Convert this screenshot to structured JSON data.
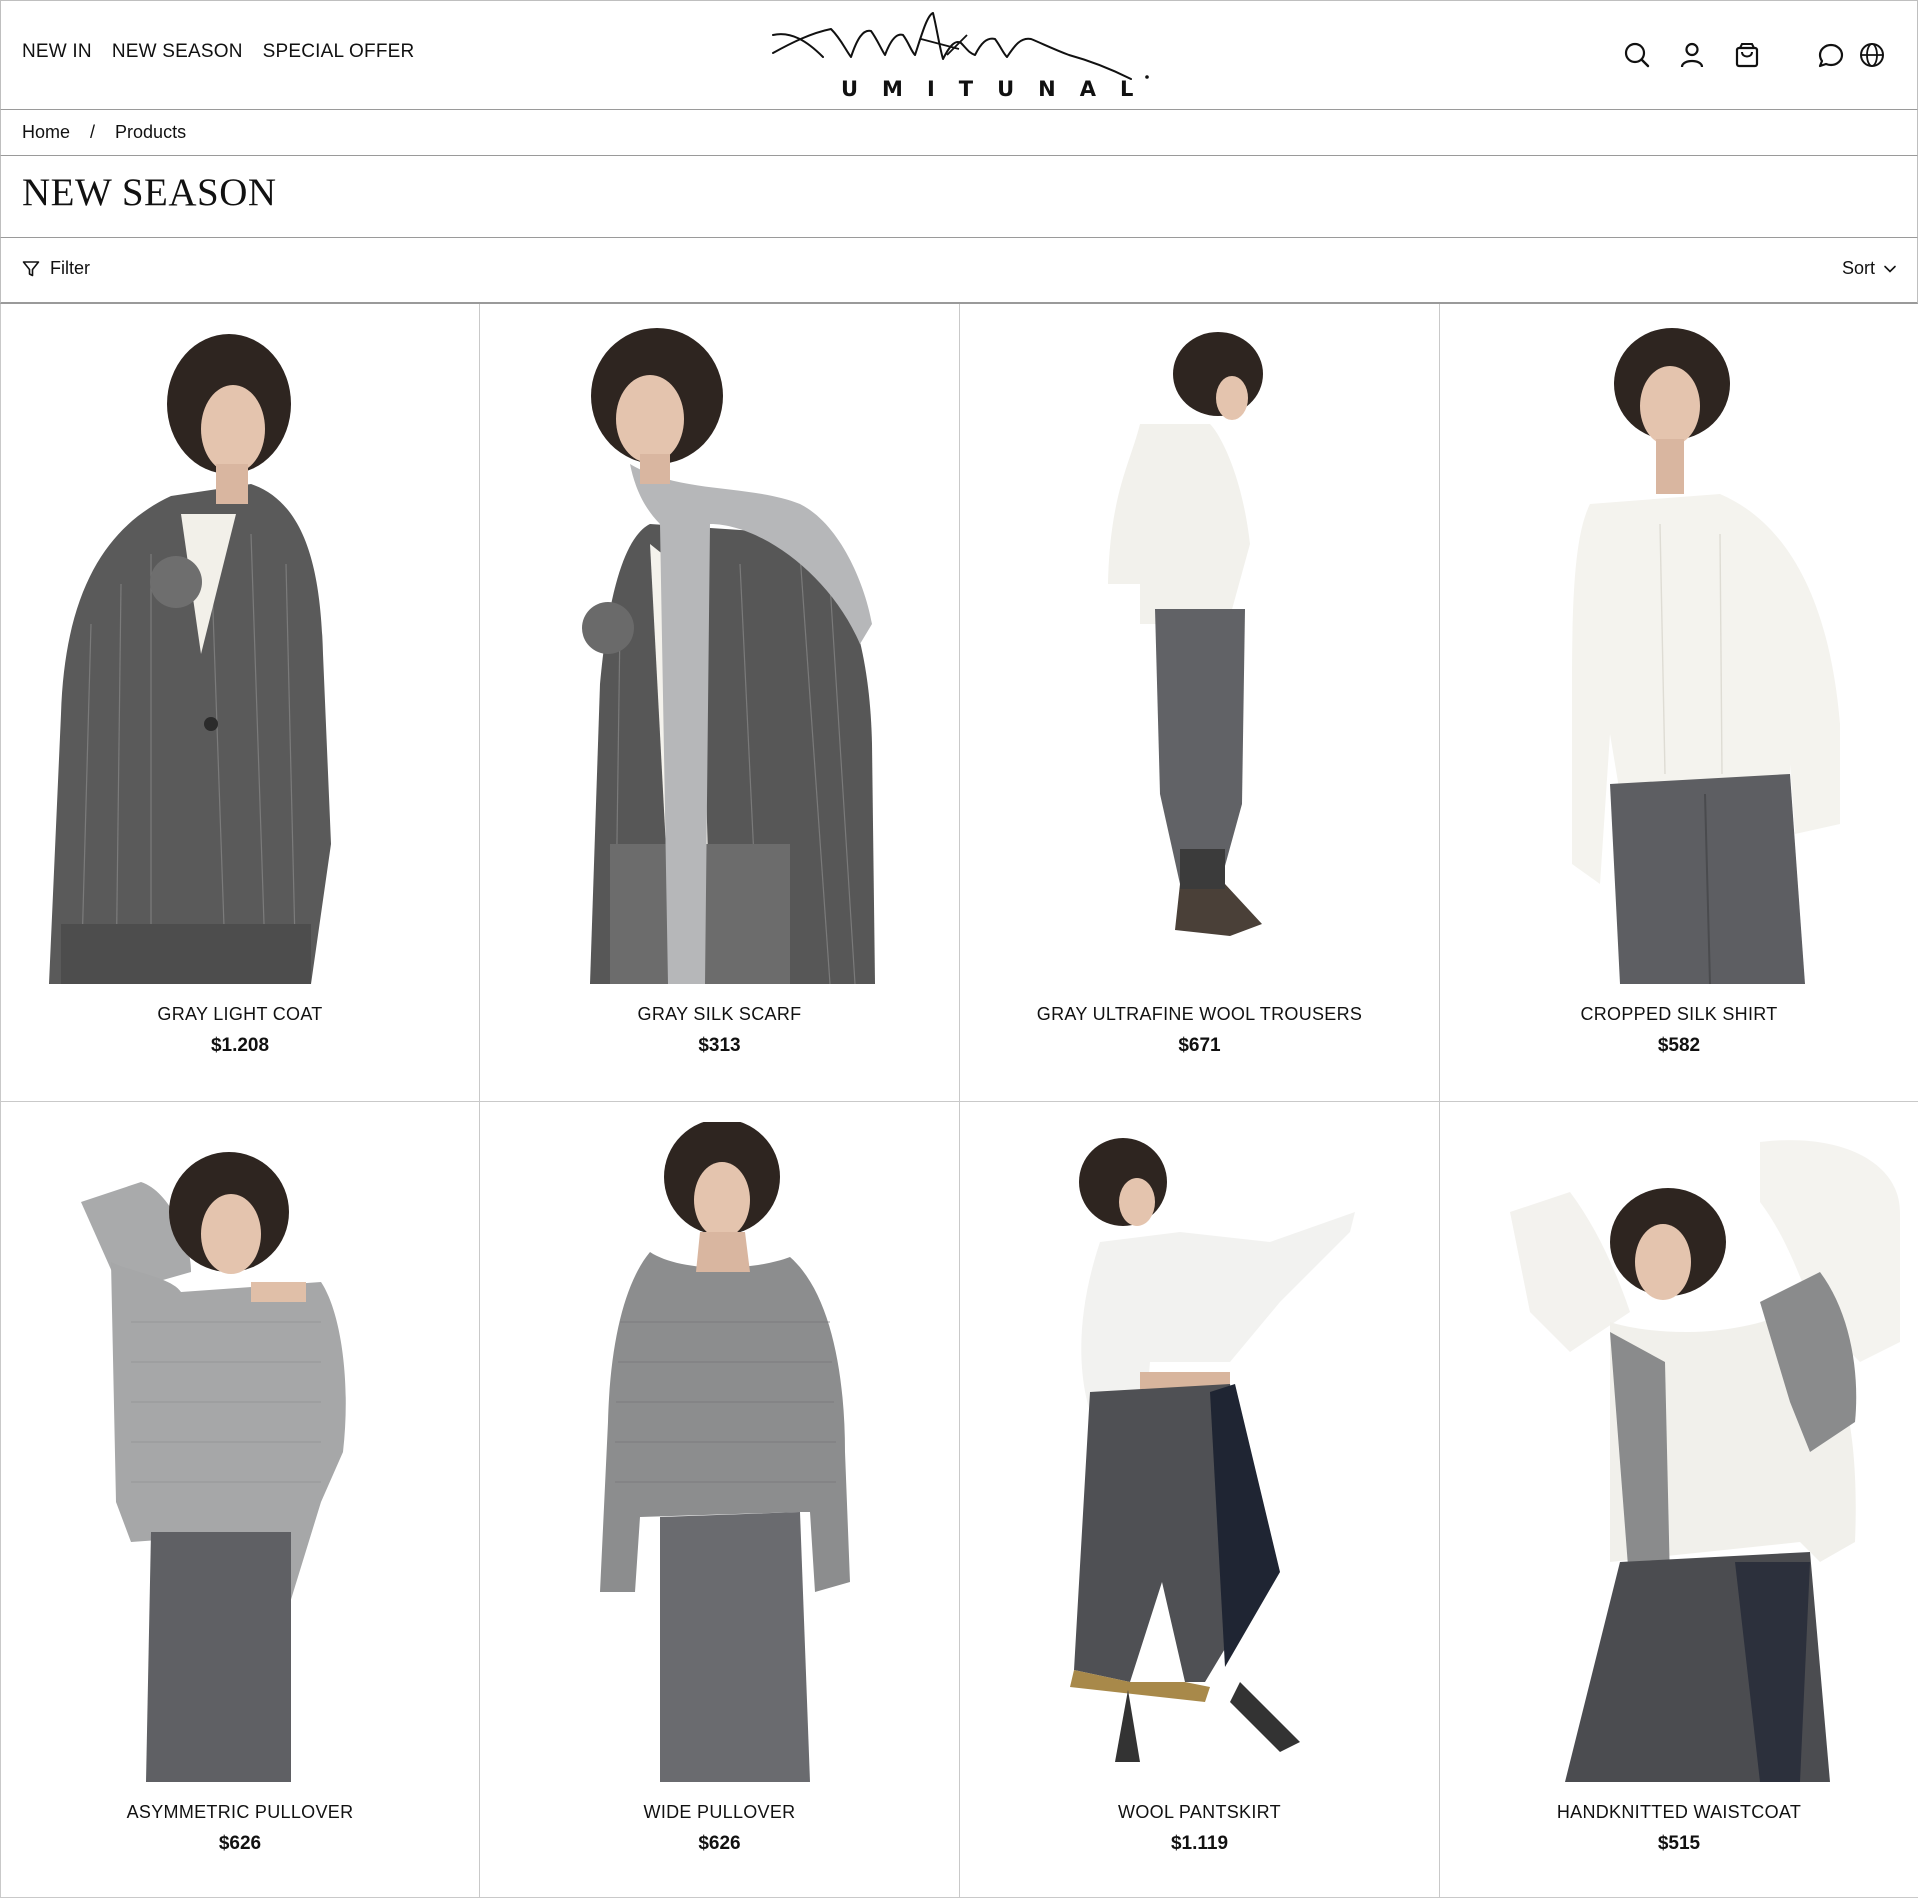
{
  "header": {
    "nav": [
      "NEW IN",
      "NEW SEASON",
      "SPECIAL OFFER"
    ],
    "brand": "UMITUNAL"
  },
  "icons": {
    "search": "search-icon",
    "account": "user-icon",
    "cart": "shopping-bag-icon",
    "chat": "chat-bubble-icon",
    "language": "globe-icon"
  },
  "breadcrumb": {
    "home": "Home",
    "separator": "/",
    "current": "Products"
  },
  "page": {
    "title": "NEW SEASON"
  },
  "toolbar": {
    "filter": "Filter",
    "sort": "Sort"
  },
  "products": [
    {
      "name": "GRAY LIGHT COAT",
      "price": "$1.208"
    },
    {
      "name": "GRAY SILK SCARF",
      "price": "$313"
    },
    {
      "name": "GRAY ULTRAFINE WOOL TROUSERS",
      "price": "$671"
    },
    {
      "name": "CROPPED SILK SHIRT",
      "price": "$582"
    },
    {
      "name": "ASYMMETRIC PULLOVER",
      "price": "$626"
    },
    {
      "name": "WIDE PULLOVER",
      "price": "$626"
    },
    {
      "name": "WOOL PANTSKIRT",
      "price": "$1.119"
    },
    {
      "name": "HANDKNITTED WAISTCOAT",
      "price": "$515"
    }
  ],
  "colors": {
    "text": "#111111",
    "border": "#c9c9c9",
    "background": "#ffffff"
  }
}
